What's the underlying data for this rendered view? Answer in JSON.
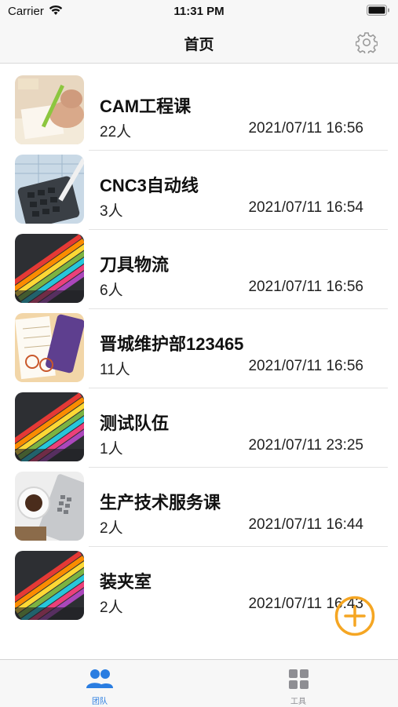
{
  "status_bar": {
    "carrier": "Carrier",
    "time": "11:31 PM"
  },
  "nav": {
    "title": "首页",
    "settings_icon": "gear-icon"
  },
  "teams": [
    {
      "name": "CAM工程课",
      "members": "22人",
      "updated": "2021/07/11 16:56",
      "image": "writing-hand-photo"
    },
    {
      "name": "CNC3自动线",
      "members": "3人",
      "updated": "2021/07/11 16:54",
      "image": "calculator-photo"
    },
    {
      "name": "刀具物流",
      "members": "6人",
      "updated": "2021/07/11 16:56",
      "image": "colored-pencils-photo"
    },
    {
      "name": "晋城维护部123465",
      "members": "11人",
      "updated": "2021/07/11 16:56",
      "image": "notebook-glasses-photo"
    },
    {
      "name": "测试队伍",
      "members": "1人",
      "updated": "2021/07/11 23:25",
      "image": "colored-pencils-photo"
    },
    {
      "name": "生产技术服务课",
      "members": "2人",
      "updated": "2021/07/11 16:44",
      "image": "coffee-laptop-photo"
    },
    {
      "name": "装夹室",
      "members": "2人",
      "updated": "2021/07/11 16:43",
      "image": "colored-pencils-photo"
    }
  ],
  "fab": {
    "icon": "plus-circle-icon",
    "color": "#f5a623"
  },
  "tab_bar": {
    "active_color": "#2a7de1",
    "inactive_color": "#8e8e93",
    "tabs": [
      {
        "label": "团队",
        "icon": "team-icon",
        "active": true
      },
      {
        "label": "工具",
        "icon": "grid-icon",
        "active": false
      }
    ]
  }
}
